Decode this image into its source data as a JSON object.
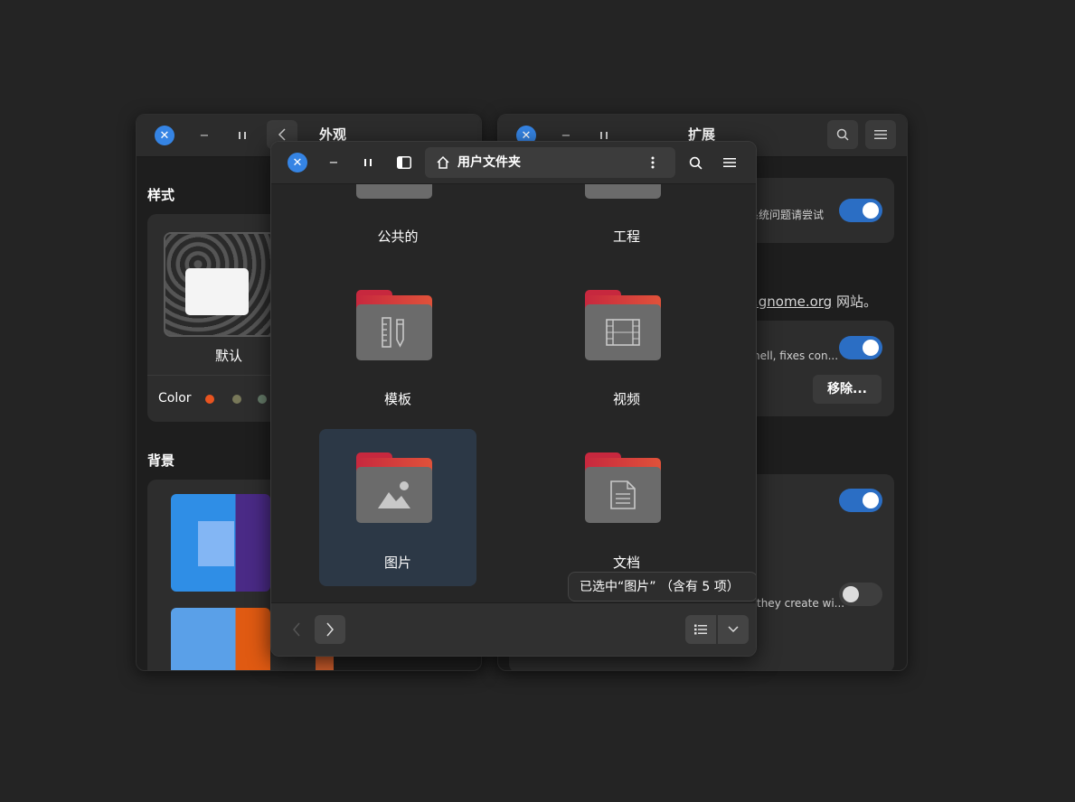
{
  "settings_left": {
    "title": "外观",
    "style_section": "样式",
    "style_option_label": "默认",
    "color_label": "Color",
    "color_dots": [
      "#e95420",
      "#787859",
      "#657b69"
    ],
    "background_section": "背景"
  },
  "settings_right": {
    "title": "扩展",
    "row1_desc": "系统问题请尝试",
    "link_text": ".gnome.org",
    "link_suffix": " 网站。",
    "row2_desc": "hell, fixes con...",
    "remove_label": "移除...",
    "row4_desc": "they create wi..."
  },
  "files": {
    "path_label": "用户文件夹",
    "folders": [
      {
        "label": "公共的",
        "icon": "folder-icon"
      },
      {
        "label": "工程",
        "icon": "folder-icon"
      },
      {
        "label": "模板",
        "icon": "template-icon"
      },
      {
        "label": "视频",
        "icon": "video-icon"
      },
      {
        "label": "图片",
        "icon": "picture-icon"
      },
      {
        "label": "文档",
        "icon": "document-icon"
      }
    ],
    "status": "已选中“图片” （含有 5 项）"
  },
  "colors": {
    "accent": "#3584e4",
    "toggle_on": "#2b6ec4",
    "folder_red": "#c7283e",
    "selection": "#2c3846"
  }
}
